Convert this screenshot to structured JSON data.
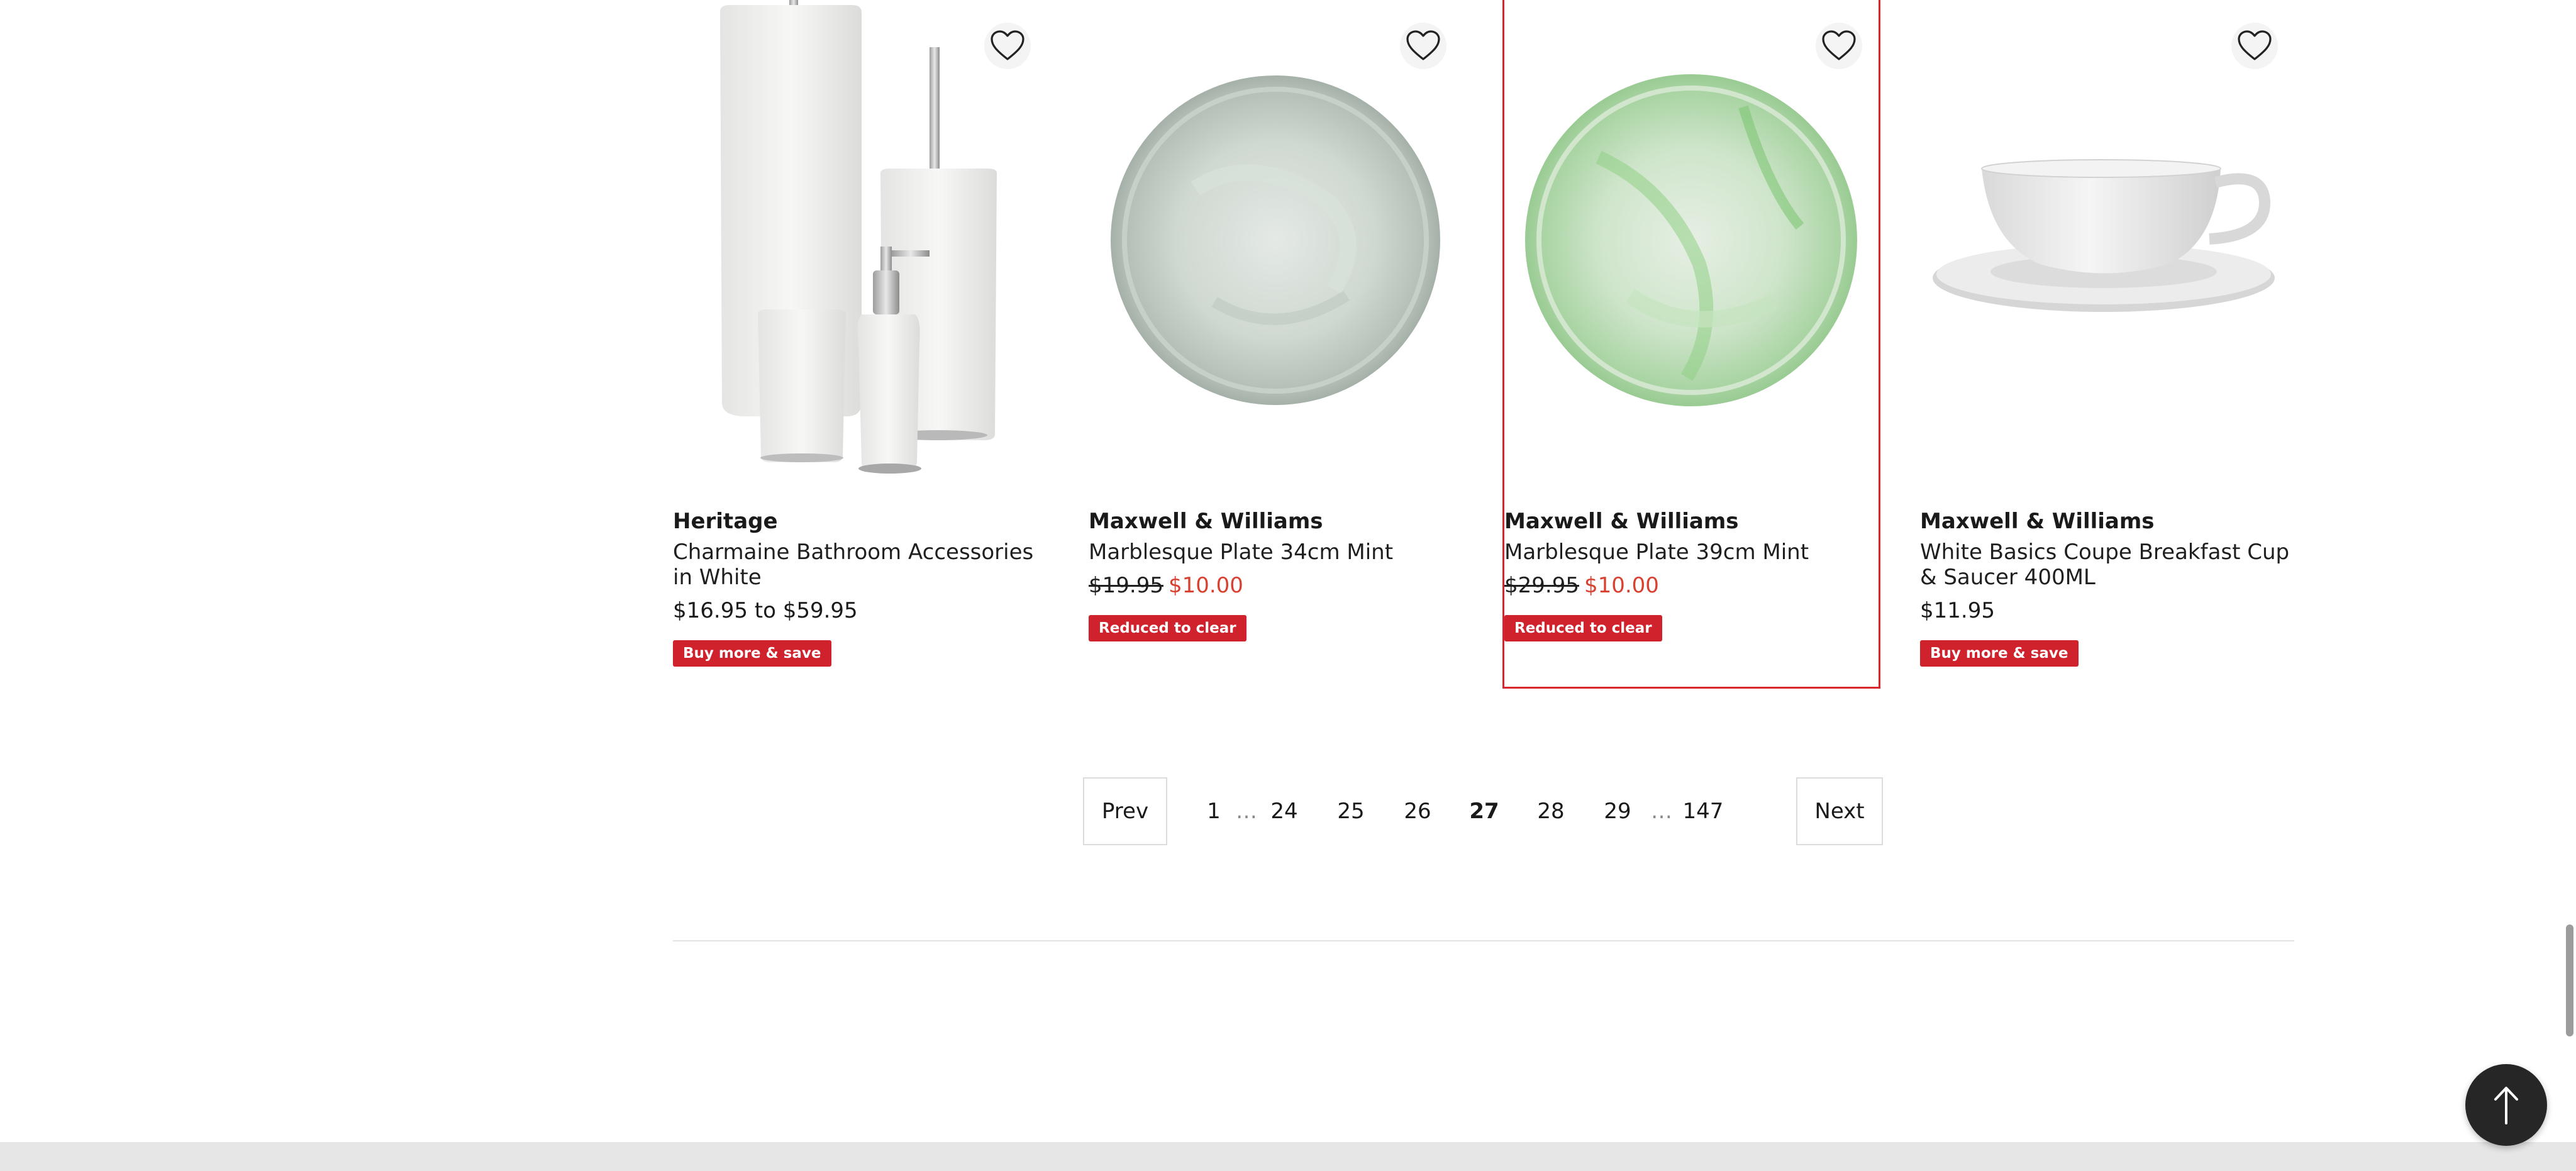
{
  "products": [
    {
      "brand": "Heritage",
      "title": "Charmaine Bathroom Accessories in White",
      "price": "$16.95 to $59.95",
      "badge": "Buy more & save",
      "image_icon": "bathroom-accessories-set-image"
    },
    {
      "brand": "Maxwell & Williams",
      "title": "Marblesque Plate 34cm Mint",
      "was_price": "$19.95",
      "now_price": "$10.00",
      "badge": "Reduced to clear",
      "image_icon": "mint-plate-image"
    },
    {
      "brand": "Maxwell & Williams",
      "title": "Marblesque Plate 39cm Mint",
      "was_price": "$29.95",
      "now_price": "$10.00",
      "badge": "Reduced to clear",
      "image_icon": "mint-plate-image"
    },
    {
      "brand": "Maxwell & Williams",
      "title": "White Basics Coupe Breakfast Cup & Saucer 400ML",
      "price": "$11.95",
      "badge": "Buy more & save",
      "image_icon": "cup-and-saucer-image"
    }
  ],
  "pagination": {
    "prev": "Prev",
    "next": "Next",
    "first": "1",
    "ellipsis": "…",
    "pages": [
      "24",
      "25",
      "26",
      "27",
      "28",
      "29"
    ],
    "current": "27",
    "last": "147"
  },
  "colors": {
    "accent": "#d8262f",
    "sale_price": "#d8402f",
    "badge_bg": "#d0222d"
  },
  "icons": {
    "favorite": "heart-icon",
    "back_to_top": "arrow-up-icon"
  }
}
